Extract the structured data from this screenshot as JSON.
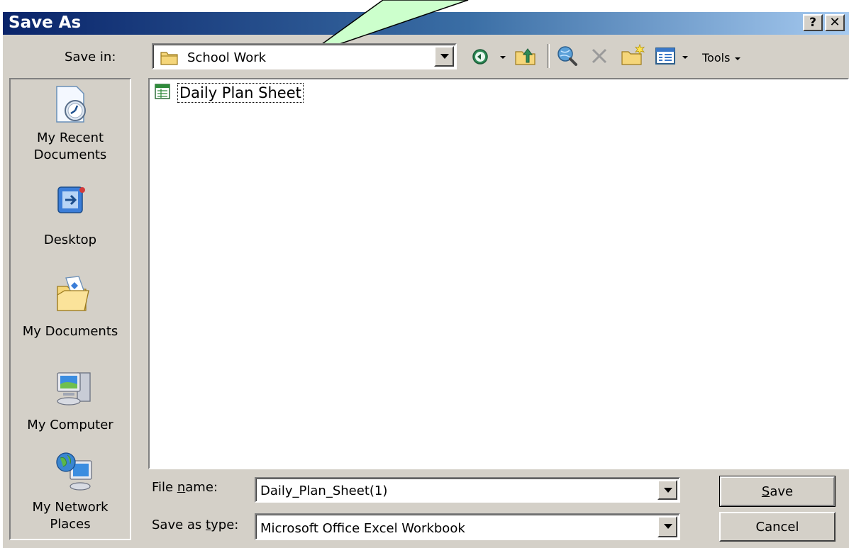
{
  "window": {
    "title": "Save As",
    "help_label": "?",
    "close_label": "✕"
  },
  "toolbar": {
    "save_in_label": "Save in:",
    "save_in_value": "School Work",
    "tools_label": "Tools"
  },
  "places": [
    {
      "line1": "My Recent",
      "line2": "Documents",
      "icon": "recent-documents-icon"
    },
    {
      "line1": "Desktop",
      "line2": "",
      "icon": "desktop-icon"
    },
    {
      "line1": "My Documents",
      "line2": "",
      "icon": "my-documents-icon"
    },
    {
      "line1": "My Computer",
      "line2": "",
      "icon": "my-computer-icon"
    },
    {
      "line1": "My Network",
      "line2": "Places",
      "icon": "network-places-icon"
    }
  ],
  "files": [
    {
      "name": "Daily Plan Sheet",
      "icon": "excel-file-icon"
    }
  ],
  "form": {
    "filename_label": "File name:",
    "filename_value": "Daily_Plan_Sheet(1)",
    "type_label": "Save as type:",
    "type_value": "Microsoft Office Excel Workbook"
  },
  "buttons": {
    "save_label": "Save",
    "cancel_label": "Cancel"
  },
  "colors": {
    "title_start": "#0a246a",
    "title_end": "#a6caf0",
    "face": "#d4d0c8",
    "callout": "#ccffcc"
  }
}
